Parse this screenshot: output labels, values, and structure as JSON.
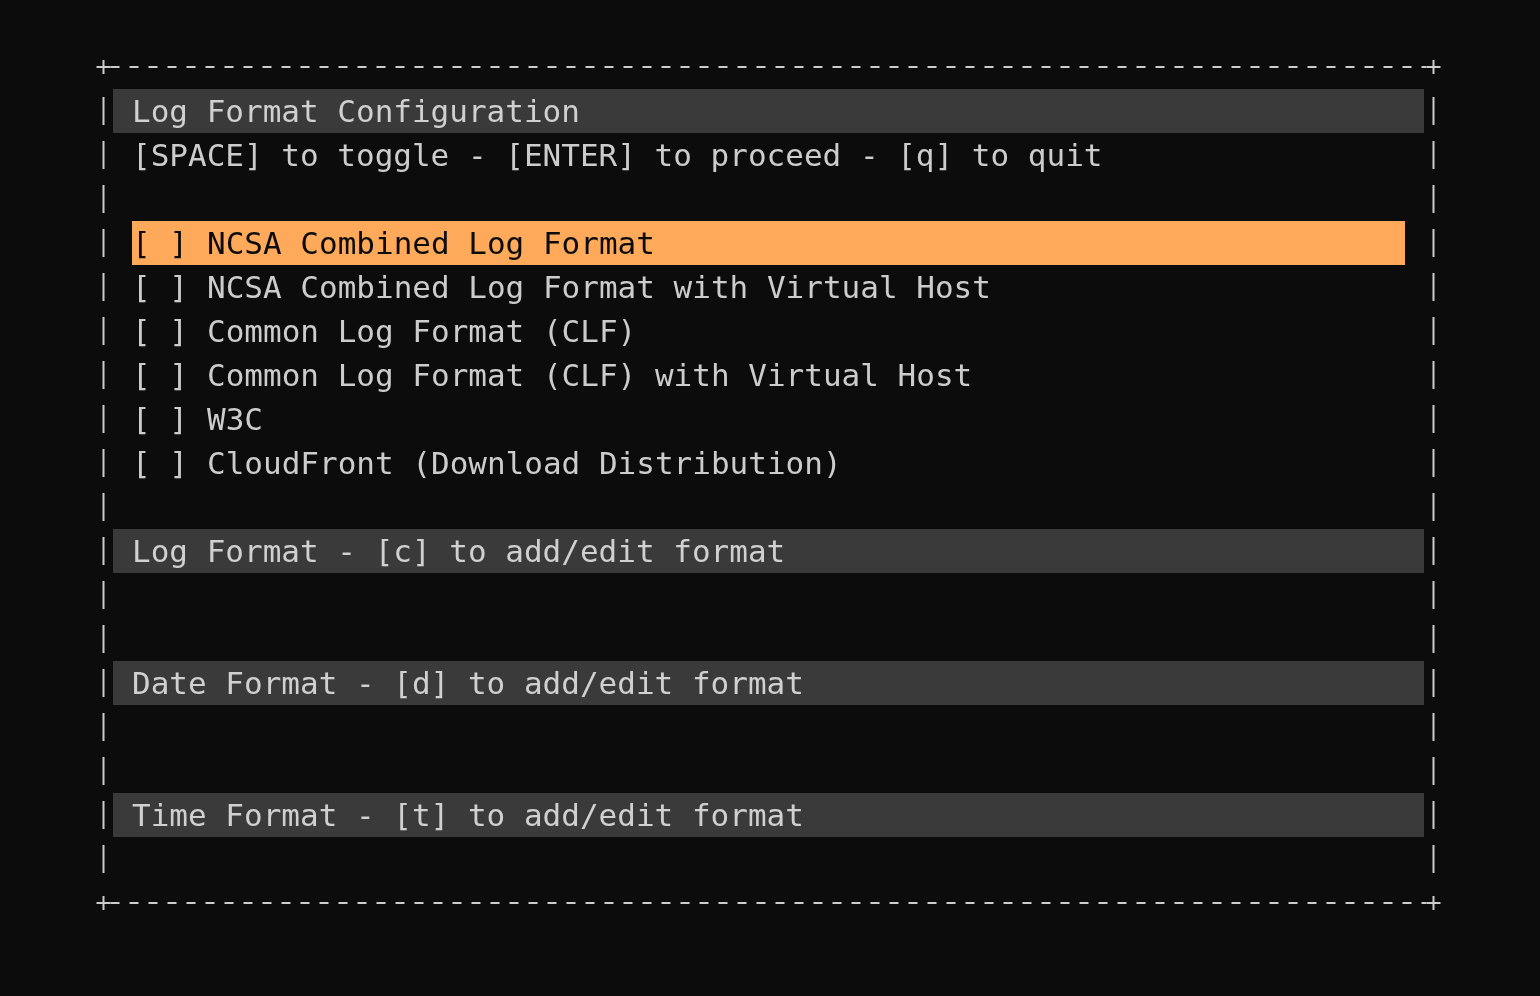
{
  "title": "Log Format Configuration",
  "hint": "[SPACE] to toggle - [ENTER] to proceed - [q] to quit",
  "options": [
    {
      "checkbox": "[ ]",
      "label": "NCSA Combined Log Format",
      "checked": false,
      "selected": true
    },
    {
      "checkbox": "[ ]",
      "label": "NCSA Combined Log Format with Virtual Host",
      "checked": false,
      "selected": false
    },
    {
      "checkbox": "[ ]",
      "label": "Common Log Format (CLF)",
      "checked": false,
      "selected": false
    },
    {
      "checkbox": "[ ]",
      "label": "Common Log Format (CLF) with Virtual Host",
      "checked": false,
      "selected": false
    },
    {
      "checkbox": "[ ]",
      "label": "W3C",
      "checked": false,
      "selected": false
    },
    {
      "checkbox": "[ ]",
      "label": "CloudFront (Download Distribution)",
      "checked": false,
      "selected": false
    }
  ],
  "sections": [
    {
      "title": "Log Format - [c] to add/edit format"
    },
    {
      "title": "Date Format - [d] to add/edit format"
    },
    {
      "title": "Time Format - [t] to add/edit format"
    }
  ]
}
